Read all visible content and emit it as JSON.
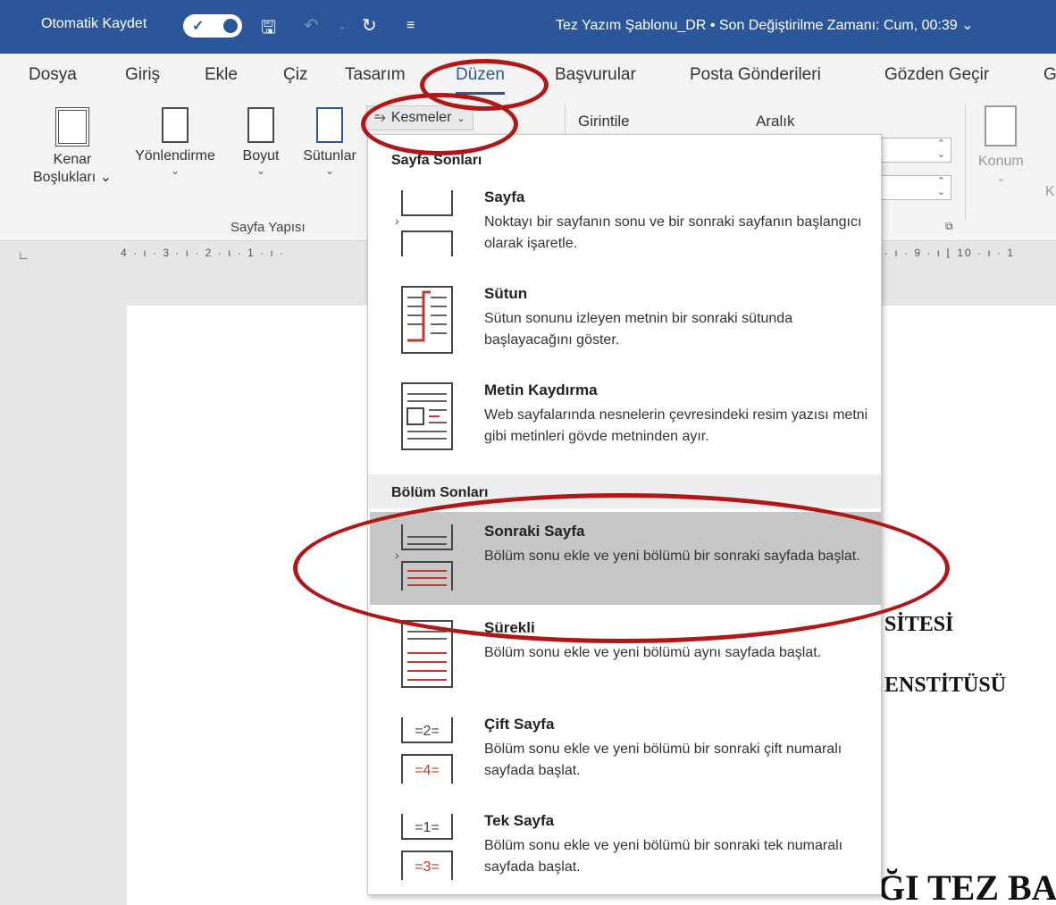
{
  "title_bar": {
    "autosave_label": "Otomatik Kaydet",
    "document_title": "Tez Yazım Şablonu_DR • Son Değiştirilme Zamanı: Cum, 00:39 ⌄"
  },
  "tabs": [
    "Dosya",
    "Giriş",
    "Ekle",
    "Çiz",
    "Tasarım",
    "Düzen",
    "Başvurular",
    "Posta Gönderileri",
    "Gözden Geçir",
    "G"
  ],
  "active_tab": "Düzen",
  "ribbon": {
    "kenar_line1": "Kenar",
    "kenar_line2": "Boşlukları ⌄",
    "yonlendirme": "Yönlendirme",
    "boyut": "Boyut",
    "sutunlar": "Sütunlar",
    "group_label": "Sayfa Yapısı",
    "breaks_button": "Kesmeler",
    "indent_label": "Girintile",
    "spacing_label": "Aralık",
    "position_label": "Konum",
    "cut_letter": "K"
  },
  "ruler": {
    "left_scale": "4 · ı · 3 · ı · 2 · ı · 1 · ı ·",
    "right_scale": "· ı · 9 · ı ⌊ 10 · ı · 1"
  },
  "menu": {
    "section_page_breaks": "Sayfa Sonları",
    "section_section_breaks": "Bölüm Sonları",
    "items": [
      {
        "title": "Sayfa",
        "desc": "Noktayı bir sayfanın sonu ve bir sonraki sayfanın başlangıcı olarak işaretle."
      },
      {
        "title": "Sütun",
        "desc": "Sütun sonunu izleyen metnin bir sonraki sütunda başlayacağını göster."
      },
      {
        "title": "Metin Kaydırma",
        "desc": "Web sayfalarında nesnelerin çevresindeki resim yazısı metni gibi metinleri gövde metninden ayır."
      },
      {
        "title": "Sonraki Sayfa",
        "desc": "Bölüm sonu ekle ve yeni bölümü bir sonraki sayfada başlat."
      },
      {
        "title": "Sürekli",
        "desc": "Bölüm sonu ekle ve yeni bölümü aynı sayfada başlat."
      },
      {
        "title": "Çift Sayfa",
        "desc": "Bölüm sonu ekle ve yeni bölümü bir sonraki çift numaralı sayfada başlat."
      },
      {
        "title": "Tek Sayfa",
        "desc": "Bölüm sonu ekle ve yeni bölümü bir sonraki tek numaralı sayfada başlat."
      }
    ],
    "highlighted_item": "Sonraki Sayfa"
  },
  "document": {
    "line1": "SİTESİ",
    "line2": "ENSTİTÜSÜ",
    "line3": "ĞI TEZ BA"
  },
  "colors": {
    "accent": "#2b579a",
    "annotation": "#b01818",
    "highlight": "#c6c6c6"
  }
}
